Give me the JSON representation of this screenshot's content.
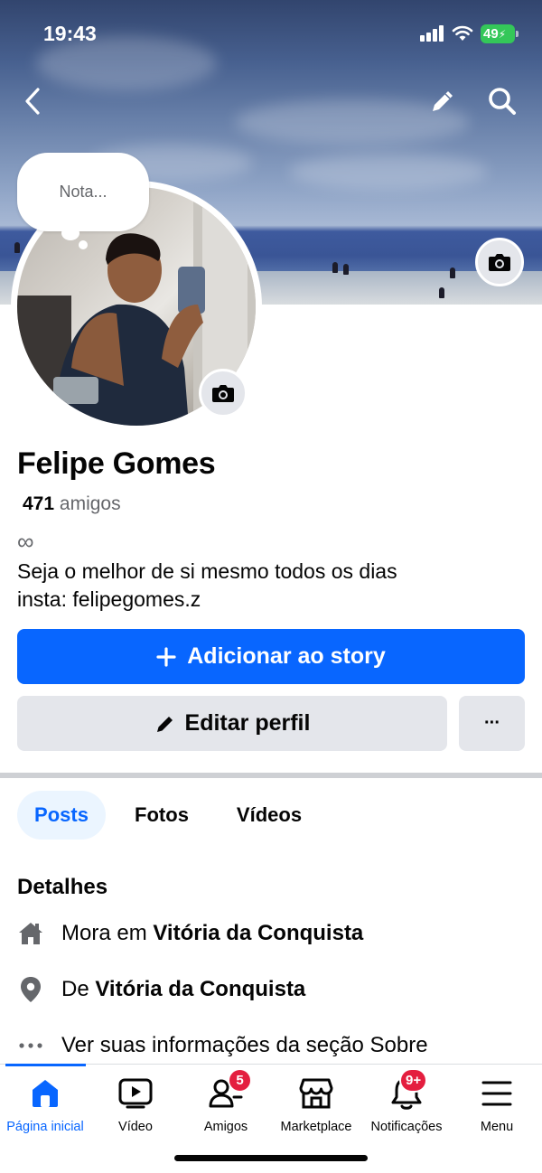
{
  "status_bar": {
    "time": "19:43",
    "battery": "49"
  },
  "profile": {
    "note_placeholder": "Nota...",
    "name": "Felipe Gomes",
    "friends_count": "471",
    "friends_label": "amigos",
    "bio_symbol": "∞",
    "bio_lines": [
      "Seja o melhor de si mesmo todos os dias",
      "insta: felipegomes.z"
    ]
  },
  "actions": {
    "add_story_label": "Adicionar ao story",
    "edit_profile_label": "Editar perfil",
    "more_label": "···"
  },
  "tabs": [
    {
      "label": "Posts",
      "active": true
    },
    {
      "label": "Fotos",
      "active": false
    },
    {
      "label": "Vídeos",
      "active": false
    }
  ],
  "details": {
    "title": "Detalhes",
    "items": [
      {
        "icon": "home-icon",
        "prefix": "Mora em ",
        "bold": "Vitória da Conquista",
        "suffix": ""
      },
      {
        "icon": "location-pin-icon",
        "prefix": "De ",
        "bold": "Vitória da Conquista",
        "suffix": ""
      },
      {
        "icon": "more-dots-icon",
        "prefix": "Ver suas informações da seção Sobre",
        "bold": "",
        "suffix": ""
      }
    ]
  },
  "bottom_nav": [
    {
      "label": "Página inicial",
      "icon": "home-icon",
      "active": true,
      "badge": ""
    },
    {
      "label": "Vídeo",
      "icon": "video-icon",
      "active": false,
      "badge": ""
    },
    {
      "label": "Amigos",
      "icon": "friends-icon",
      "active": false,
      "badge": "5"
    },
    {
      "label": "Marketplace",
      "icon": "marketplace-icon",
      "active": false,
      "badge": ""
    },
    {
      "label": "Notificações",
      "icon": "bell-icon",
      "active": false,
      "badge": "9+"
    },
    {
      "label": "Menu",
      "icon": "menu-icon",
      "active": false,
      "badge": ""
    }
  ],
  "colors": {
    "accent": "#0866ff",
    "badge": "#e41e3f",
    "secondary_button": "#e4e6eb",
    "battery": "#34c759"
  }
}
